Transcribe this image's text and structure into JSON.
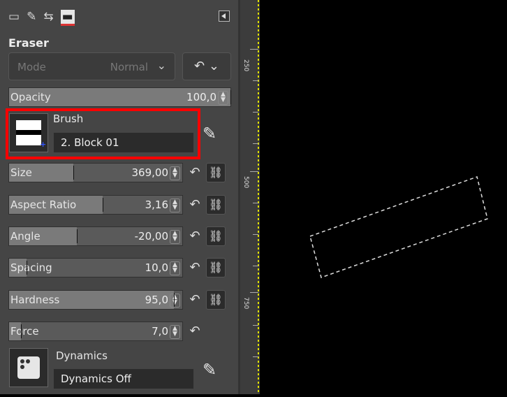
{
  "tool_options": {
    "title": "Eraser",
    "mode_label": "Mode",
    "mode_value": "Normal",
    "opacity": {
      "label": "Opacity",
      "value": "100,0",
      "fraction": 1.0
    },
    "brush": {
      "label": "Brush",
      "name": "2. Block 01"
    },
    "sliders": [
      {
        "label": "Size",
        "value": "369,00",
        "fraction": 0.37
      },
      {
        "label": "Aspect Ratio",
        "value": "3,16",
        "fraction": 0.54
      },
      {
        "label": "Angle",
        "value": "-20,00",
        "fraction": 0.39
      },
      {
        "label": "Spacing",
        "value": "10,0",
        "fraction": 0.1
      },
      {
        "label": "Hardness",
        "value": "95,0",
        "fraction": 0.95
      },
      {
        "label": "Force",
        "value": "7,0",
        "fraction": 0.07
      }
    ],
    "dynamics": {
      "label": "Dynamics",
      "name": "Dynamics Off"
    }
  },
  "ruler": {
    "labels": [
      "250",
      "500",
      "750"
    ]
  },
  "icons": {
    "tabs": [
      "device-icon",
      "tool-options-icon",
      "undo-history-icon",
      "images-icon"
    ],
    "menu": "panel-menu-icon",
    "reset": "reset-icon",
    "chain": "chain-link-icon",
    "edit": "edit-icon"
  },
  "colors": {
    "highlight": "#ff0000",
    "selection": "#dddddd"
  }
}
